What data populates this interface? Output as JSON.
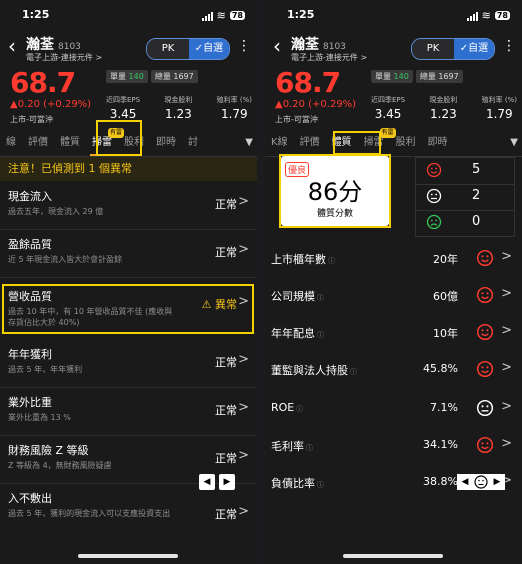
{
  "status": {
    "time": "1:25",
    "battery": "78"
  },
  "stock": {
    "name": "瀚荃",
    "code": "8103",
    "industry": "電子上游-連接元件",
    "industry_arrow": ">",
    "price": "68.7",
    "change": "▲0.20 (+0.29%)",
    "tradeable": "上市-可當沖",
    "vol_single_label": "單量",
    "vol_single": "140",
    "vol_total_label": "總量",
    "vol_total": "1697",
    "metrics": [
      {
        "label": "近四季EPS",
        "value": "3.45"
      },
      {
        "label": "現金股利",
        "value": "1.23"
      },
      {
        "label": "殖利率 (%)",
        "value": "1.79"
      }
    ]
  },
  "header": {
    "back": "‹",
    "pk": "PK",
    "watch": "✓自選",
    "more": "⋮"
  },
  "left": {
    "tabs": [
      "線",
      "評價",
      "體質",
      "掃雷",
      "股利",
      "即時",
      "討"
    ],
    "tab_badge": "有雷",
    "caret": "▼",
    "alert": "注意！已偵測到 1 個異常",
    "rows": [
      {
        "title": "現金流入",
        "sub": "過去五年，現金流入 29 億",
        "status": "正常",
        "warn": false
      },
      {
        "title": "盈餘品質",
        "sub": "近 5 年現金流入皆大於會計盈餘",
        "status": "正常",
        "warn": false
      },
      {
        "title": "營收品質",
        "sub": "過去 10 年中，有 10 年營收品質不佳 (應收與存貨佔比大於 40%)",
        "status": "⚠ 異常",
        "warn": true
      },
      {
        "title": "年年獲利",
        "sub": "過去 5 年，年年獲利",
        "status": "正常",
        "warn": false
      },
      {
        "title": "業外比重",
        "sub": "業外比重為 13 %",
        "status": "正常",
        "warn": false
      },
      {
        "title": "財務風險 Z 等級",
        "sub": "Z 等級為 4，無財務風險疑慮",
        "status": "正常",
        "warn": false
      },
      {
        "title": "入不敷出",
        "sub": "過去 5 年，獲利的現金流入可以支應投資支出",
        "status": "正常",
        "warn": false
      }
    ],
    "chevron": ">",
    "nav_left": "◀",
    "nav_right": "▶"
  },
  "right": {
    "tabs": [
      "K線",
      "評價",
      "體質",
      "掃雷",
      "股利",
      "即時"
    ],
    "tab_badge": "有雷",
    "caret": "▼",
    "score": {
      "badge": "優良",
      "value": "86分",
      "label": "體質分數"
    },
    "counts": [
      {
        "face": "happy-face-icon",
        "color": "#ff3b30",
        "value": "5"
      },
      {
        "face": "neutral-face-icon",
        "color": "#ffffff",
        "value": "2"
      },
      {
        "face": "sad-face-icon",
        "color": "#34c759",
        "value": "0"
      }
    ],
    "info_glyph": "ⓘ",
    "metrics": [
      {
        "label": "上市櫃年數",
        "value": "20年",
        "face": "happy"
      },
      {
        "label": "公司規模",
        "value": "60億",
        "face": "happy"
      },
      {
        "label": "年年配息",
        "value": "10年",
        "face": "happy"
      },
      {
        "label": "董監與法人持股",
        "value": "45.8%",
        "face": "happy"
      },
      {
        "label": "ROE",
        "value": "7.1%",
        "face": "neutral"
      },
      {
        "label": "毛利率",
        "value": "34.1%",
        "face": "happy"
      },
      {
        "label": "負債比率",
        "value": "38.8%",
        "face": "neutral"
      }
    ],
    "chevron": ">",
    "nav_left": "◀",
    "nav_right": "▶"
  },
  "colors": {
    "up": "#ff3b30",
    "highlight": "#f5d000",
    "warn": "#f5c518",
    "neutral": "#ffffff",
    "down": "#34c759"
  }
}
